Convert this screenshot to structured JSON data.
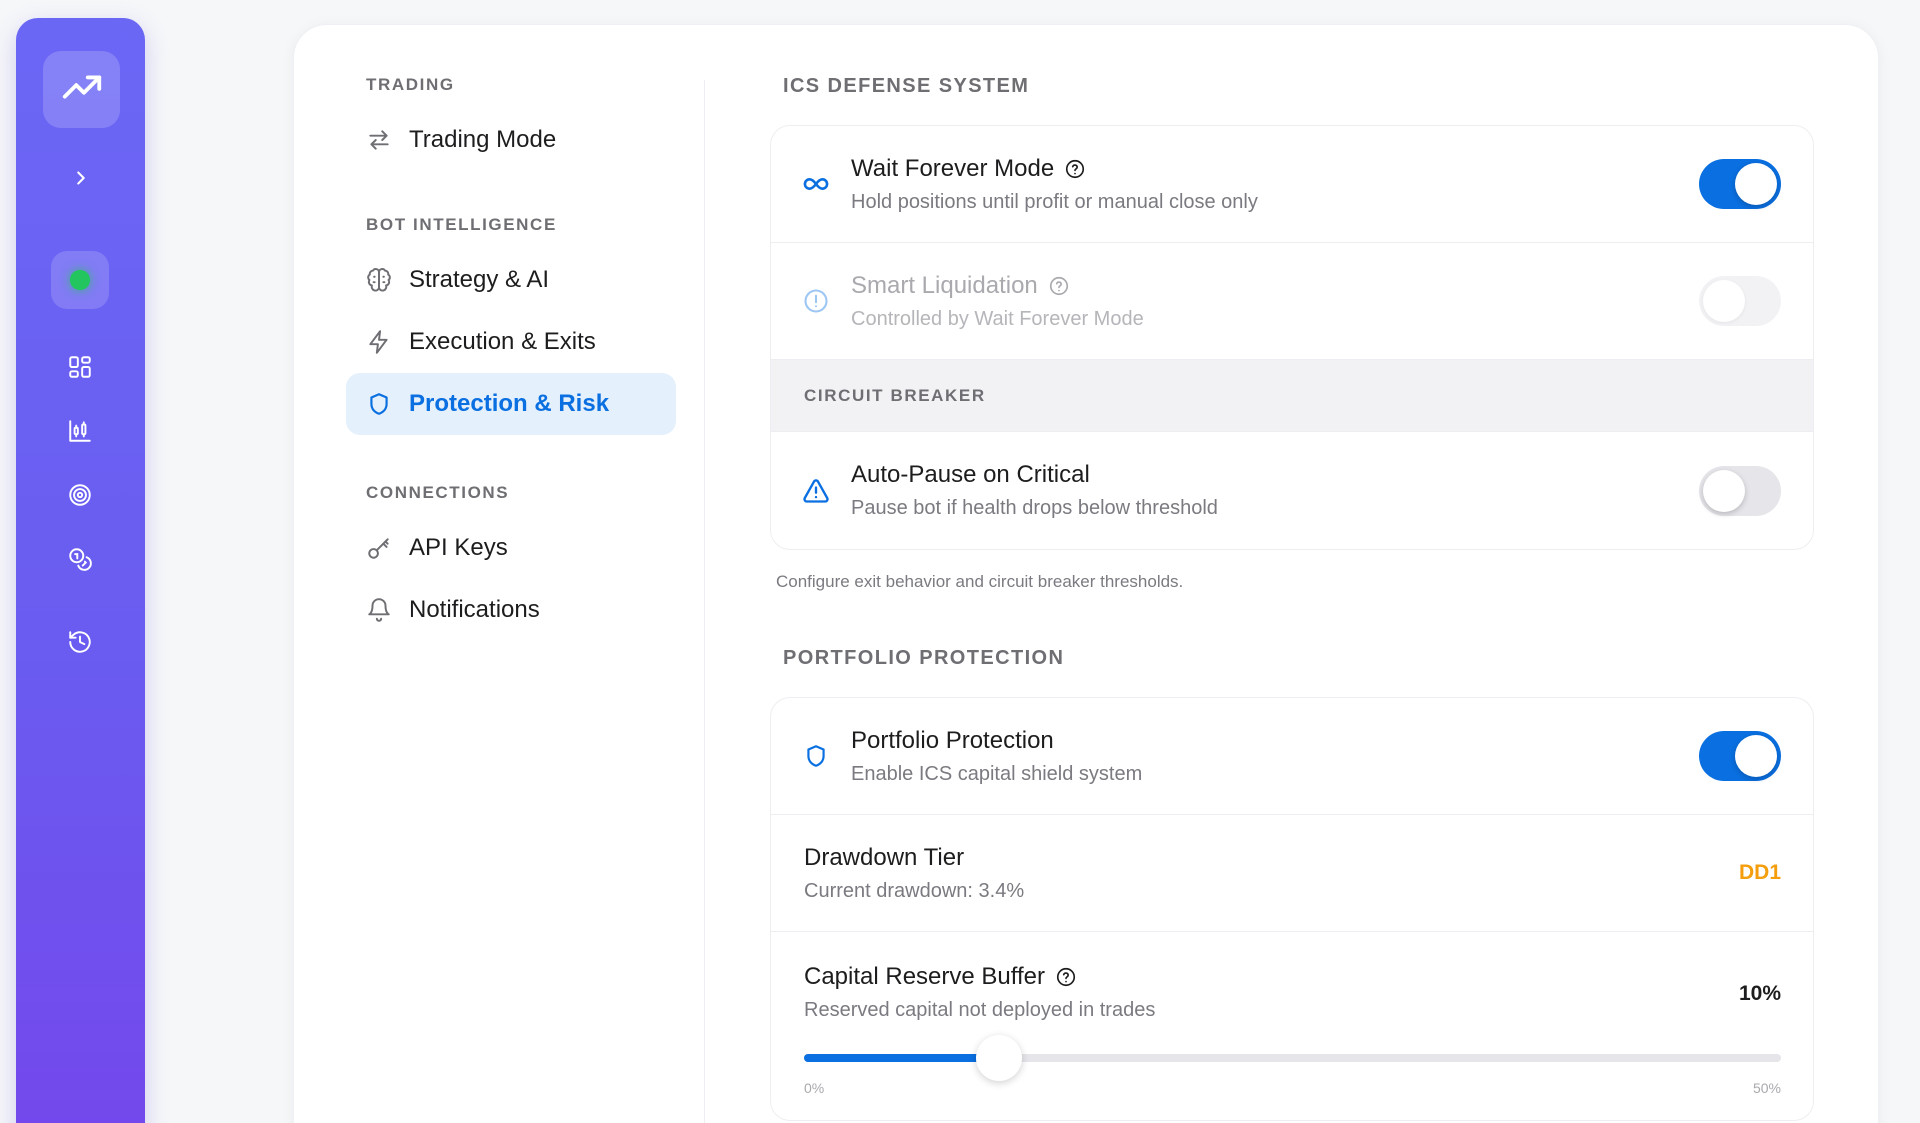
{
  "colors": {
    "accent": "#0a6fe0",
    "warning": "#f59e0b",
    "status_online": "#22c55e",
    "rail_gradient_top": "#6b67f5",
    "rail_gradient_bottom": "#7447ec"
  },
  "rail": {
    "logo_icon": "trending-up-icon",
    "expand_icon": "chevron-right-icon",
    "status": "online",
    "items": [
      {
        "icon": "dashboard-grid-icon"
      },
      {
        "icon": "chart-bars-icon"
      },
      {
        "icon": "target-icon"
      },
      {
        "icon": "coins-icon"
      },
      {
        "icon": "history-icon"
      }
    ]
  },
  "nav": {
    "sections": [
      {
        "label": "TRADING",
        "items": [
          {
            "label": "Trading Mode",
            "icon": "swap-arrows-icon"
          }
        ]
      },
      {
        "label": "BOT INTELLIGENCE",
        "items": [
          {
            "label": "Strategy & AI",
            "icon": "brain-icon"
          },
          {
            "label": "Execution & Exits",
            "icon": "lightning-icon"
          },
          {
            "label": "Protection & Risk",
            "icon": "shield-icon",
            "active": true
          }
        ]
      },
      {
        "label": "CONNECTIONS",
        "items": [
          {
            "label": "API Keys",
            "icon": "key-icon"
          },
          {
            "label": "Notifications",
            "icon": "bell-icon"
          }
        ]
      }
    ]
  },
  "ics": {
    "title": "ICS DEFENSE SYSTEM",
    "wait_forever": {
      "title": "Wait Forever Mode",
      "subtitle": "Hold positions until profit or manual close only",
      "enabled": true,
      "icon": "infinity-icon"
    },
    "smart_liquidation": {
      "title": "Smart Liquidation",
      "subtitle": "Controlled by Wait Forever Mode",
      "enabled": false,
      "disabled": true,
      "icon": "alert-circle-icon"
    },
    "circuit_breaker_label": "CIRCUIT BREAKER",
    "auto_pause": {
      "title": "Auto-Pause on Critical",
      "subtitle": "Pause bot if health drops below threshold",
      "enabled": false,
      "icon": "warning-triangle-icon"
    },
    "note": "Configure exit behavior and circuit breaker thresholds."
  },
  "portfolio": {
    "title": "PORTFOLIO PROTECTION",
    "protection": {
      "title": "Portfolio Protection",
      "subtitle": "Enable ICS capital shield system",
      "enabled": true,
      "icon": "shield-icon"
    },
    "drawdown": {
      "title": "Drawdown Tier",
      "subtitle": "Current drawdown: 3.4%",
      "value": "DD1"
    },
    "reserve": {
      "title": "Capital Reserve Buffer",
      "subtitle": "Reserved capital not deployed in trades",
      "value_label": "10%",
      "value": 10,
      "min": 0,
      "max": 50,
      "min_label": "0%",
      "max_label": "50%"
    }
  }
}
